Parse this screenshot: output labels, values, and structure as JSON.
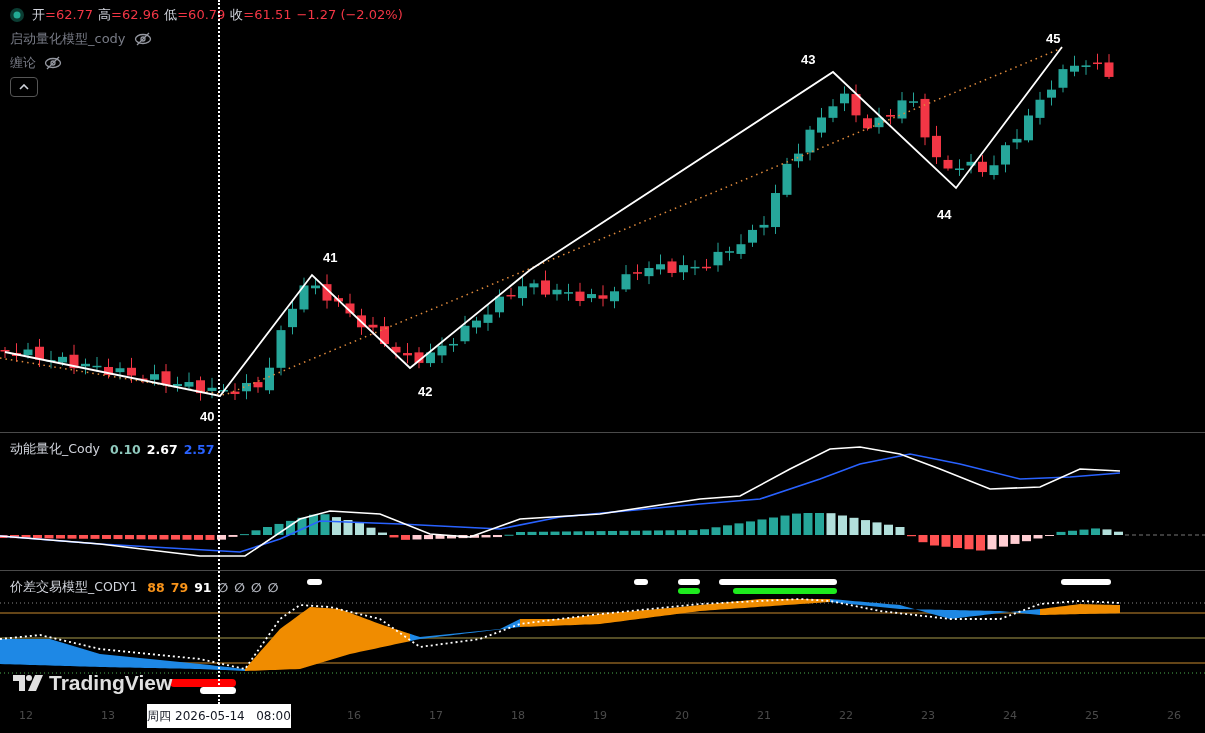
{
  "legend": {
    "ohlc": [
      {
        "label": "开",
        "value": "=62.77"
      },
      {
        "label": "高",
        "value": "=62.96"
      },
      {
        "label": "低",
        "value": "=60.79"
      },
      {
        "label": "收",
        "value": "=61.51"
      }
    ],
    "change": "−1.27 (−2.02%)",
    "indicators": [
      {
        "name": "启动量化模型_cody",
        "hidden": true
      },
      {
        "name": "缠论",
        "hidden": true
      }
    ]
  },
  "wave_labels": [
    "40",
    "41",
    "42",
    "43",
    "44",
    "45"
  ],
  "momentum_pane": {
    "title": "动能量化_Cody",
    "values": [
      {
        "text": "0.10",
        "color": "#8fc9bd"
      },
      {
        "text": "2.67",
        "color": "#ffffff"
      },
      {
        "text": "2.57",
        "color": "#2962ff"
      }
    ]
  },
  "spread_pane": {
    "title": "价差交易模型_CODY1",
    "values": [
      {
        "text": "88",
        "color": "#f7931a"
      },
      {
        "text": "79",
        "color": "#f7931a"
      },
      {
        "text": "91",
        "color": "#ffffff"
      },
      {
        "text": "∅",
        "color": "#b2b5be"
      },
      {
        "text": "∅",
        "color": "#b2b5be"
      },
      {
        "text": "∅",
        "color": "#b2b5be"
      },
      {
        "text": "∅",
        "color": "#b2b5be"
      }
    ]
  },
  "logo": "TradingView",
  "time_axis": [
    "12",
    "13",
    "16",
    "17",
    "18",
    "19",
    "20",
    "21",
    "22",
    "23",
    "24",
    "25",
    "26"
  ],
  "crosshair_label": "周四 2026-05-14   08:00"
}
